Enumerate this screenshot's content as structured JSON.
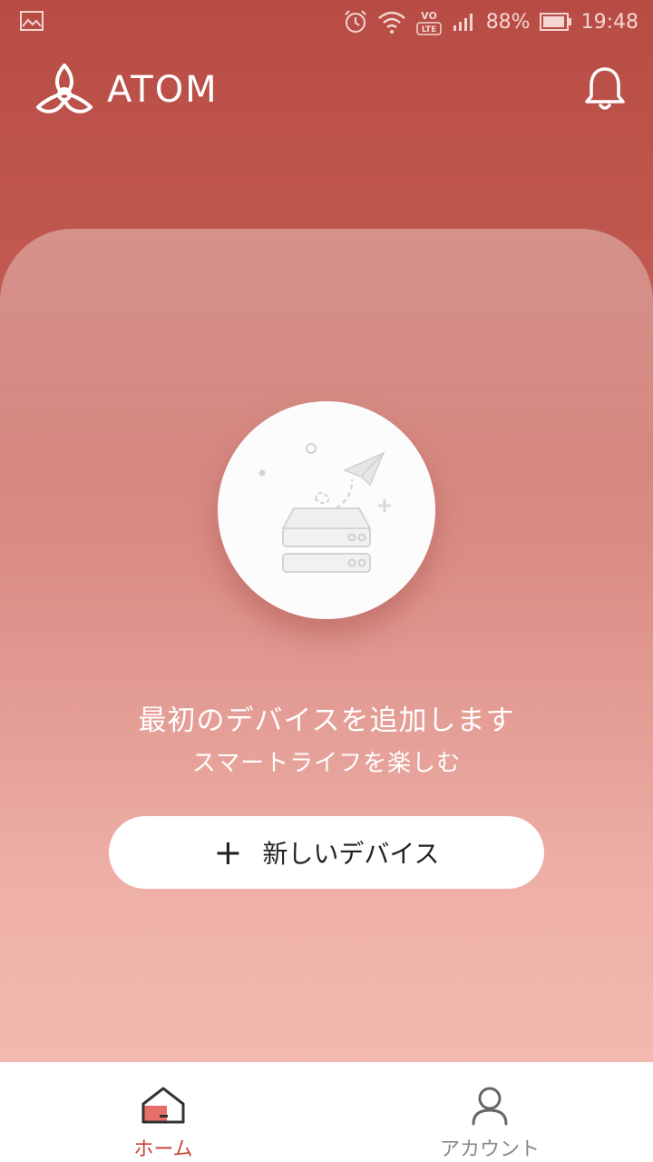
{
  "status_bar": {
    "battery": "88%",
    "time": "19:48",
    "volte": "VO LTE"
  },
  "app": {
    "brand": "ATOM"
  },
  "empty_state": {
    "title": "最初のデバイスを追加します",
    "subtitle": "スマートライフを楽しむ",
    "add_button_label": "新しいデバイス",
    "add_button_icon": "+"
  },
  "bottom_nav": {
    "items": [
      {
        "label": "ホーム",
        "icon": "home-icon",
        "active": true
      },
      {
        "label": "アカウント",
        "icon": "person-icon",
        "active": false
      }
    ]
  },
  "colors": {
    "header": "#b84c44",
    "accent": "#c8453a"
  }
}
